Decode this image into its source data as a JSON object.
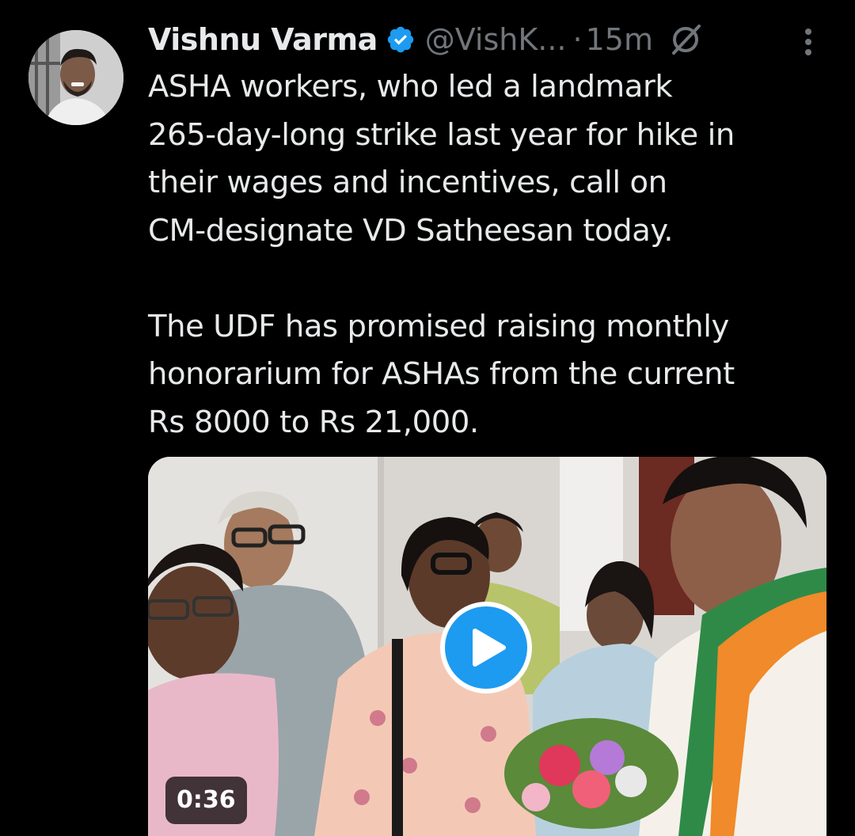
{
  "author": {
    "name": "Vishnu Varma",
    "handle": "@VishK...",
    "separator": "·",
    "time": "15m"
  },
  "icons": {
    "verified": "verified-badge-icon",
    "grok": "grok-icon",
    "more": "more-vertical-icon",
    "play": "play-icon"
  },
  "tweet": {
    "text": "ASHA workers, who led a landmark\n265-day-long strike last year for hike in\ntheir wages and incentives, call on\nCM-designate VD Satheesan today.\n\nThe UDF has promised raising monthly\nhonorarium for ASHAs from the current\nRs 8000 to Rs 21,000."
  },
  "media": {
    "duration": "0:36"
  },
  "colors": {
    "background": "#000000",
    "text": "#e7e9ea",
    "secondary": "#71767b",
    "accent": "#1d9bf0"
  }
}
